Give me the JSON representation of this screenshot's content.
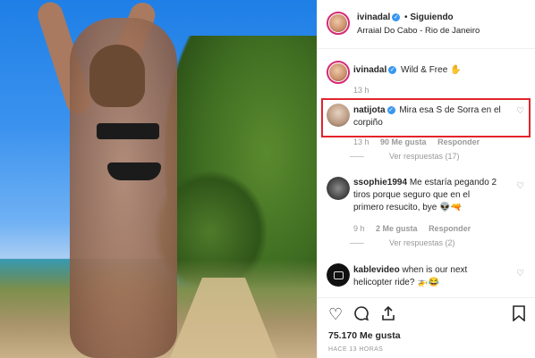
{
  "post": {
    "author": "ivinadal",
    "follow_status": "Siguiendo",
    "location": "Arraial Do Cabo - Rio de Janeiro",
    "separator": "•"
  },
  "caption": {
    "author": "ivinadal",
    "text": "Wild & Free ✋",
    "time": "13 h"
  },
  "comments": [
    {
      "user": "natijota",
      "text": "Mira esa S de Sorra en el corpiño",
      "time": "13 h",
      "likes": "90 Me gusta",
      "reply_label": "Responder",
      "replies": "Ver respuestas (17)"
    },
    {
      "user": "ssophie1994",
      "text": "Me estaría pegando 2 tiros porque seguro que en el primero resucito, bye 👽🔫",
      "time": "9 h",
      "likes": "2 Me gusta",
      "reply_label": "Responder",
      "replies": "Ver respuestas (2)"
    },
    {
      "user": "kablevideo",
      "text": "when is our next helicopter ride? 🚁😂",
      "time": "",
      "likes": "",
      "reply_label": "",
      "replies": ""
    }
  ],
  "footer": {
    "likes": "75.170 Me gusta",
    "timestamp": "HACE 13 HORAS"
  },
  "icons": {
    "like": "heart-icon",
    "comment": "comment-icon",
    "share": "share-icon",
    "save": "bookmark-icon"
  },
  "colors": {
    "highlight": "#e2242b",
    "verified": "#3897f0"
  }
}
